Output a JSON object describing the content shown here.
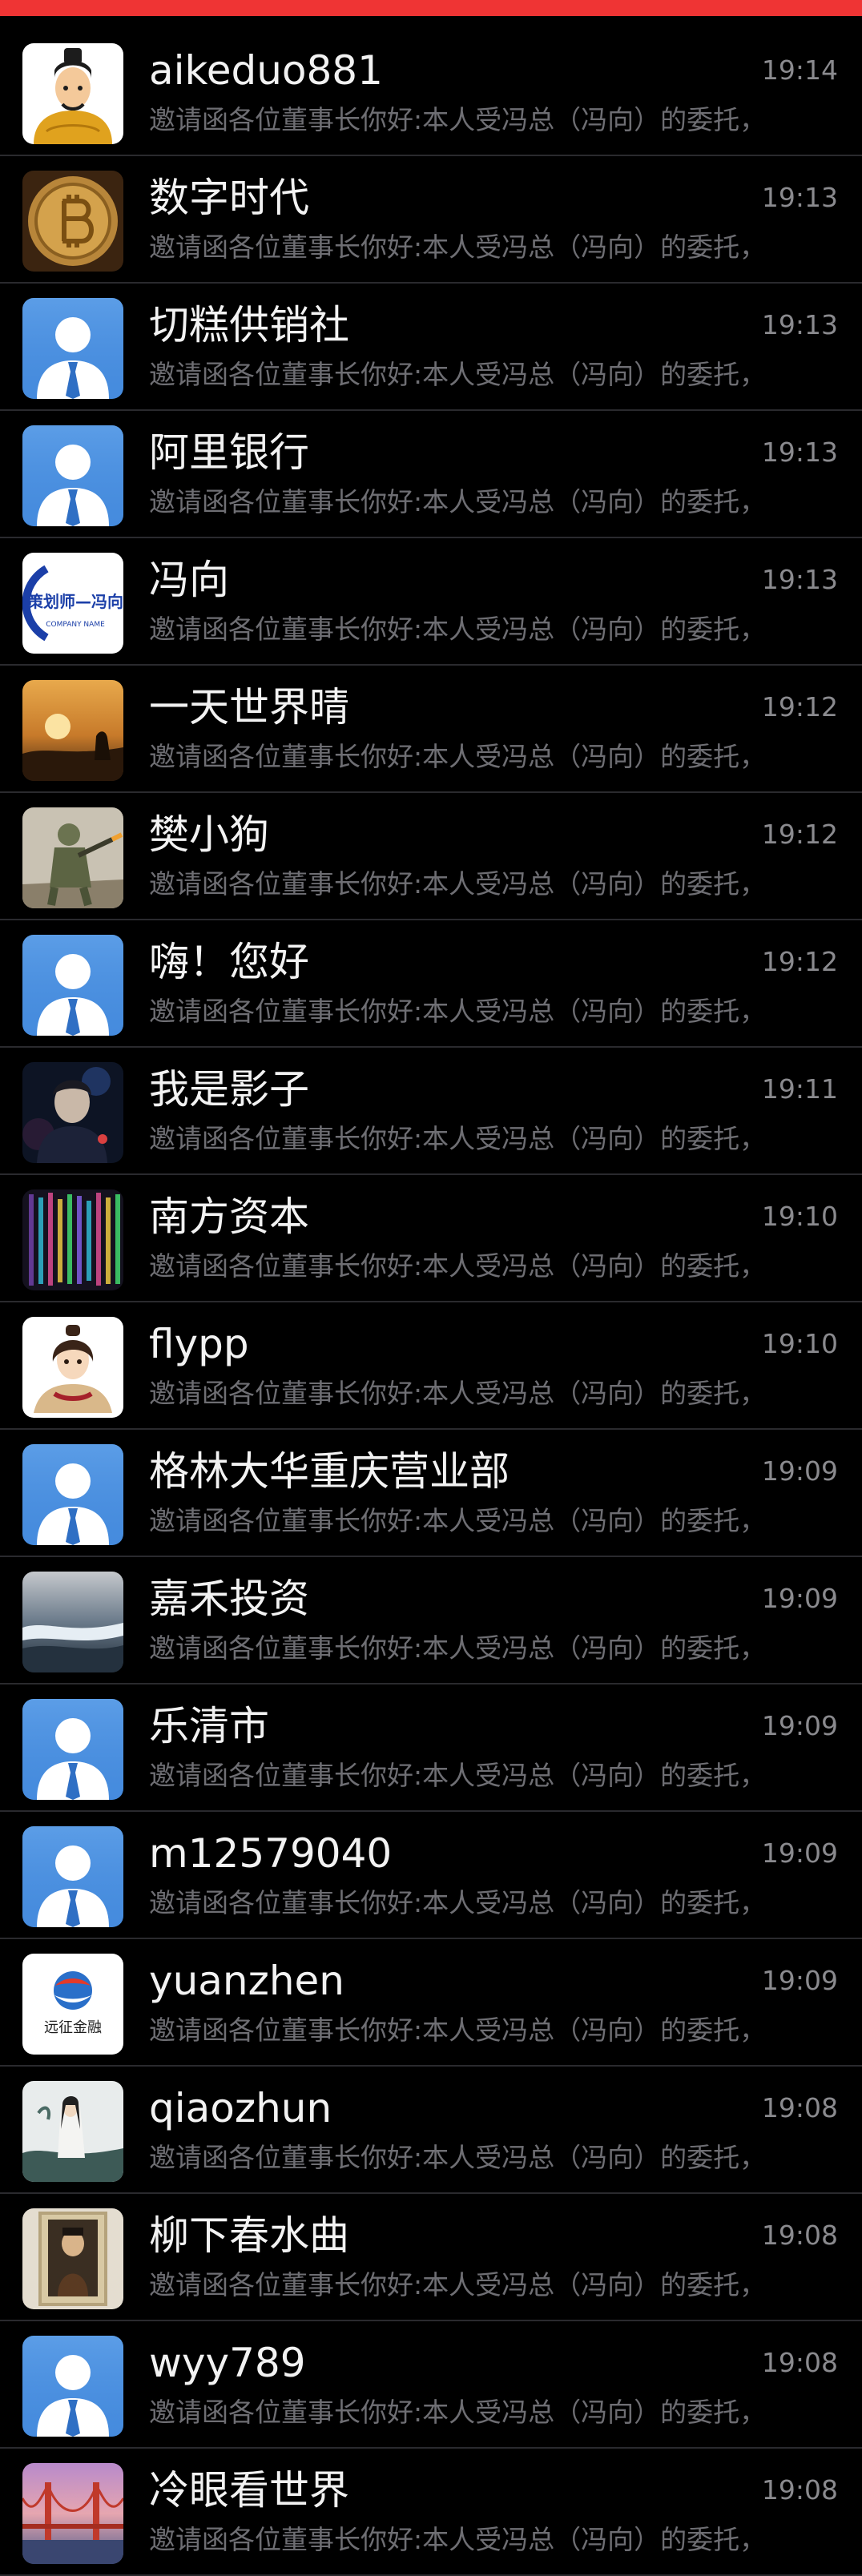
{
  "header": {
    "accent_color": "#ef3434"
  },
  "chats": [
    {
      "name": "aikeduo881",
      "time": "19:14",
      "preview": "邀请函各位董事长你好:本人受冯总（冯向）的委托，",
      "avatar": "cartoon-emperor"
    },
    {
      "name": "数字时代",
      "time": "19:13",
      "preview": "邀请函各位董事长你好:本人受冯总（冯向）的委托，",
      "avatar": "bitcoin-coin"
    },
    {
      "name": "切糕供销社",
      "time": "19:13",
      "preview": "邀请函各位董事长你好:本人受冯总（冯向）的委托，",
      "avatar": "default-user"
    },
    {
      "name": "阿里银行",
      "time": "19:13",
      "preview": "邀请函各位董事长你好:本人受冯总（冯向）的委托，",
      "avatar": "default-user"
    },
    {
      "name": "冯向",
      "time": "19:13",
      "preview": "邀请函各位董事长你好:本人受冯总（冯向）的委托，",
      "avatar": "logo-badge",
      "logo_text": "策划师—冯向"
    },
    {
      "name": "一天世界晴",
      "time": "19:12",
      "preview": "邀请函各位董事长你好:本人受冯总（冯向）的委托，",
      "avatar": "sunset-photo"
    },
    {
      "name": "樊小狗",
      "time": "19:12",
      "preview": "邀请函各位董事长你好:本人受冯总（冯向）的委托，",
      "avatar": "soldier-photo"
    },
    {
      "name": "嗨！您好",
      "time": "19:12",
      "preview": "邀请函各位董事长你好:本人受冯总（冯向）的委托，",
      "avatar": "default-user"
    },
    {
      "name": "我是影子",
      "time": "19:11",
      "preview": "邀请函各位董事长你好:本人受冯总（冯向）的委托，",
      "avatar": "dark-portrait"
    },
    {
      "name": "南方资本",
      "time": "19:10",
      "preview": "邀请函各位董事长你好:本人受冯总（冯向）的委托，",
      "avatar": "data-screen"
    },
    {
      "name": "flypp",
      "time": "19:10",
      "preview": "邀请函各位董事长你好:本人受冯总（冯向）的委托，",
      "avatar": "cartoon-girl"
    },
    {
      "name": "格林大华重庆营业部",
      "time": "19:09",
      "preview": "邀请函各位董事长你好:本人受冯总（冯向）的委托，",
      "avatar": "default-user"
    },
    {
      "name": "嘉禾投资",
      "time": "19:09",
      "preview": "邀请函各位董事长你好:本人受冯总（冯向）的委托，",
      "avatar": "ocean-wave"
    },
    {
      "name": "乐清市",
      "time": "19:09",
      "preview": "邀请函各位董事长你好:本人受冯总（冯向）的委托，",
      "avatar": "default-user"
    },
    {
      "name": "m12579040",
      "time": "19:09",
      "preview": "邀请函各位董事长你好:本人受冯总（冯向）的委托，",
      "avatar": "default-user"
    },
    {
      "name": "yuanzhen",
      "time": "19:09",
      "preview": "邀请函各位董事长你好:本人受冯总（冯向）的委托，",
      "avatar": "finance-logo",
      "logo_text": "远征金融"
    },
    {
      "name": "qiaozhun",
      "time": "19:08",
      "preview": "邀请函各位董事长你好:本人受冯总（冯向）的委托，",
      "avatar": "ink-painting"
    },
    {
      "name": "柳下春水曲",
      "time": "19:08",
      "preview": "邀请函各位董事长你好:本人受冯总（冯向）的委托，",
      "avatar": "framed-portrait"
    },
    {
      "name": "wyy789",
      "time": "19:08",
      "preview": "邀请函各位董事长你好:本人受冯总（冯向）的委托，",
      "avatar": "default-user"
    },
    {
      "name": "冷眼看世界",
      "time": "19:08",
      "preview": "邀请函各位董事长你好:本人受冯总（冯向）的委托，",
      "avatar": "golden-gate-bridge"
    }
  ]
}
